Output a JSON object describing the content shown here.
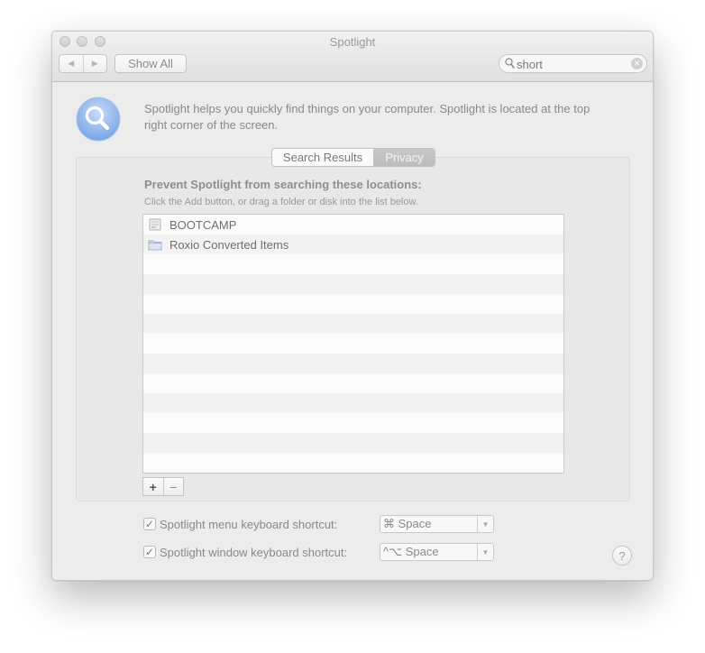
{
  "window": {
    "title": "Spotlight"
  },
  "toolbar": {
    "back_icon": "back-arrow-icon",
    "forward_icon": "forward-arrow-icon",
    "show_all_label": "Show All",
    "search_value": "short",
    "search_icon": "magnifier-icon",
    "clear_icon": "clear-x-icon"
  },
  "header": {
    "icon": "spotlight-icon",
    "description": "Spotlight helps you quickly find things on your computer. Spotlight is located at the top right corner of the screen."
  },
  "tabs": [
    {
      "label": "Search Results",
      "active": false
    },
    {
      "label": "Privacy",
      "active": true
    }
  ],
  "privacy": {
    "heading": "Prevent Spotlight from searching these locations:",
    "instructions": "Click the Add button, or drag a folder or disk into the list below.",
    "items": [
      {
        "label": "BOOTCAMP",
        "icon": "disk-icon"
      },
      {
        "label": "Roxio Converted Items",
        "icon": "folder-icon"
      }
    ],
    "add_label": "+",
    "remove_label": "−"
  },
  "shortcuts": [
    {
      "label": "Spotlight menu keyboard shortcut:",
      "checked": true,
      "value": "⌘ Space"
    },
    {
      "label": "Spotlight window keyboard shortcut:",
      "checked": true,
      "value": "^⌥ Space"
    }
  ],
  "help_label": "?",
  "colors": {
    "accent_tab": "#bdbdbd",
    "icon_blue": "#8fb7ee"
  }
}
